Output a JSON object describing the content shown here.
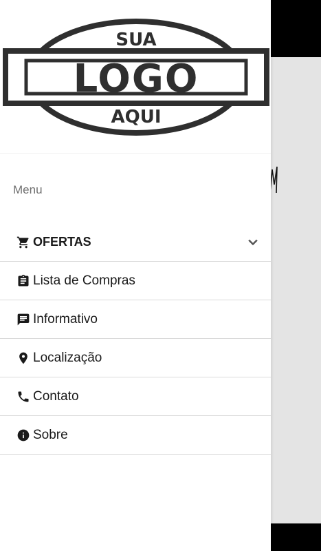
{
  "logo": {
    "top": "SUA",
    "main": "LOGO",
    "bottom": "AQUI"
  },
  "drawer": {
    "menu_title": "Menu",
    "items": [
      {
        "label": "OFERTAS",
        "icon": "cart-icon",
        "expandable": true
      },
      {
        "label": "Lista de Compras",
        "icon": "clipboard-icon"
      },
      {
        "label": "Informativo",
        "icon": "message-icon"
      },
      {
        "label": "Localização",
        "icon": "location-pin-icon"
      },
      {
        "label": "Contato",
        "icon": "phone-icon"
      },
      {
        "label": "Sobre",
        "icon": "info-icon"
      }
    ]
  },
  "colors": {
    "drawer_bg": "#ffffff",
    "text": "#1a1a1a",
    "muted": "#707070",
    "divider": "#d9d9d9",
    "logo": "#2f2f2f"
  }
}
